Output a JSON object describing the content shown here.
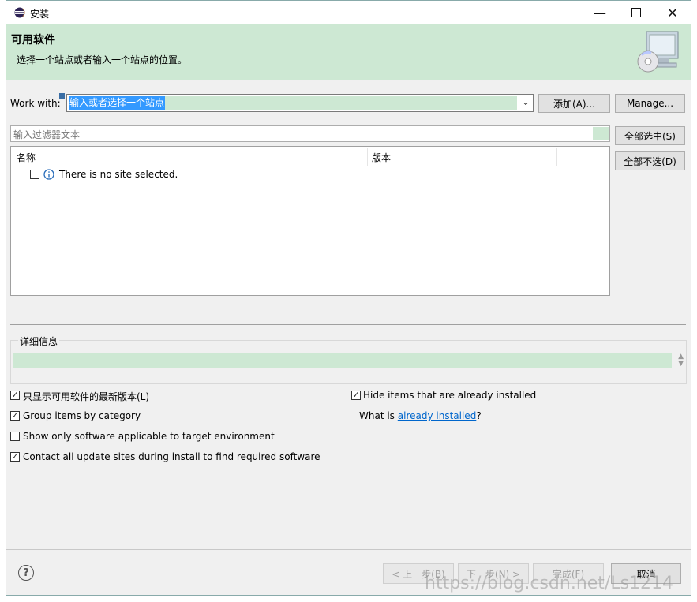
{
  "window": {
    "title": "安装"
  },
  "header": {
    "title": "可用软件",
    "subtitle": "选择一个站点或者输入一个站点的位置。"
  },
  "work_with": {
    "label": "Work with:",
    "value": "输入或者选择一个站点",
    "add_label": "添加(A)...",
    "manage_label": "Manage..."
  },
  "filter": {
    "placeholder": "输入过滤器文本"
  },
  "side_buttons": {
    "select_all": "全部选中(S)",
    "deselect_all": "全部不选(D)"
  },
  "tree": {
    "col_name": "名称",
    "col_version": "版本",
    "rows": [
      {
        "text": "There is no site selected.",
        "checked": false
      }
    ]
  },
  "details": {
    "label": "详细信息"
  },
  "options": {
    "latest_only": {
      "label": "只显示可用软件的最新版本(L)",
      "checked": true
    },
    "group_by_category": {
      "label": "Group items by category",
      "checked": true
    },
    "target_env_only": {
      "label": "Show only software applicable to target environment",
      "checked": false
    },
    "contact_all_sites": {
      "label": "Contact all update sites during install to find required software",
      "checked": true
    },
    "hide_installed": {
      "label": "Hide items that are already installed",
      "checked": true
    },
    "what_is_prefix": "What is",
    "what_is_link": "already installed",
    "what_is_suffix": "?"
  },
  "footer": {
    "back": "< 上一步(B)",
    "next": "下一步(N) >",
    "finish": "完成(F)",
    "cancel": "取消"
  },
  "watermark": "https://blog.csdn.net/Ls1214",
  "colors": {
    "accent_green": "#cde8d3",
    "selection_blue": "#3399ff",
    "link_blue": "#0066cc"
  }
}
